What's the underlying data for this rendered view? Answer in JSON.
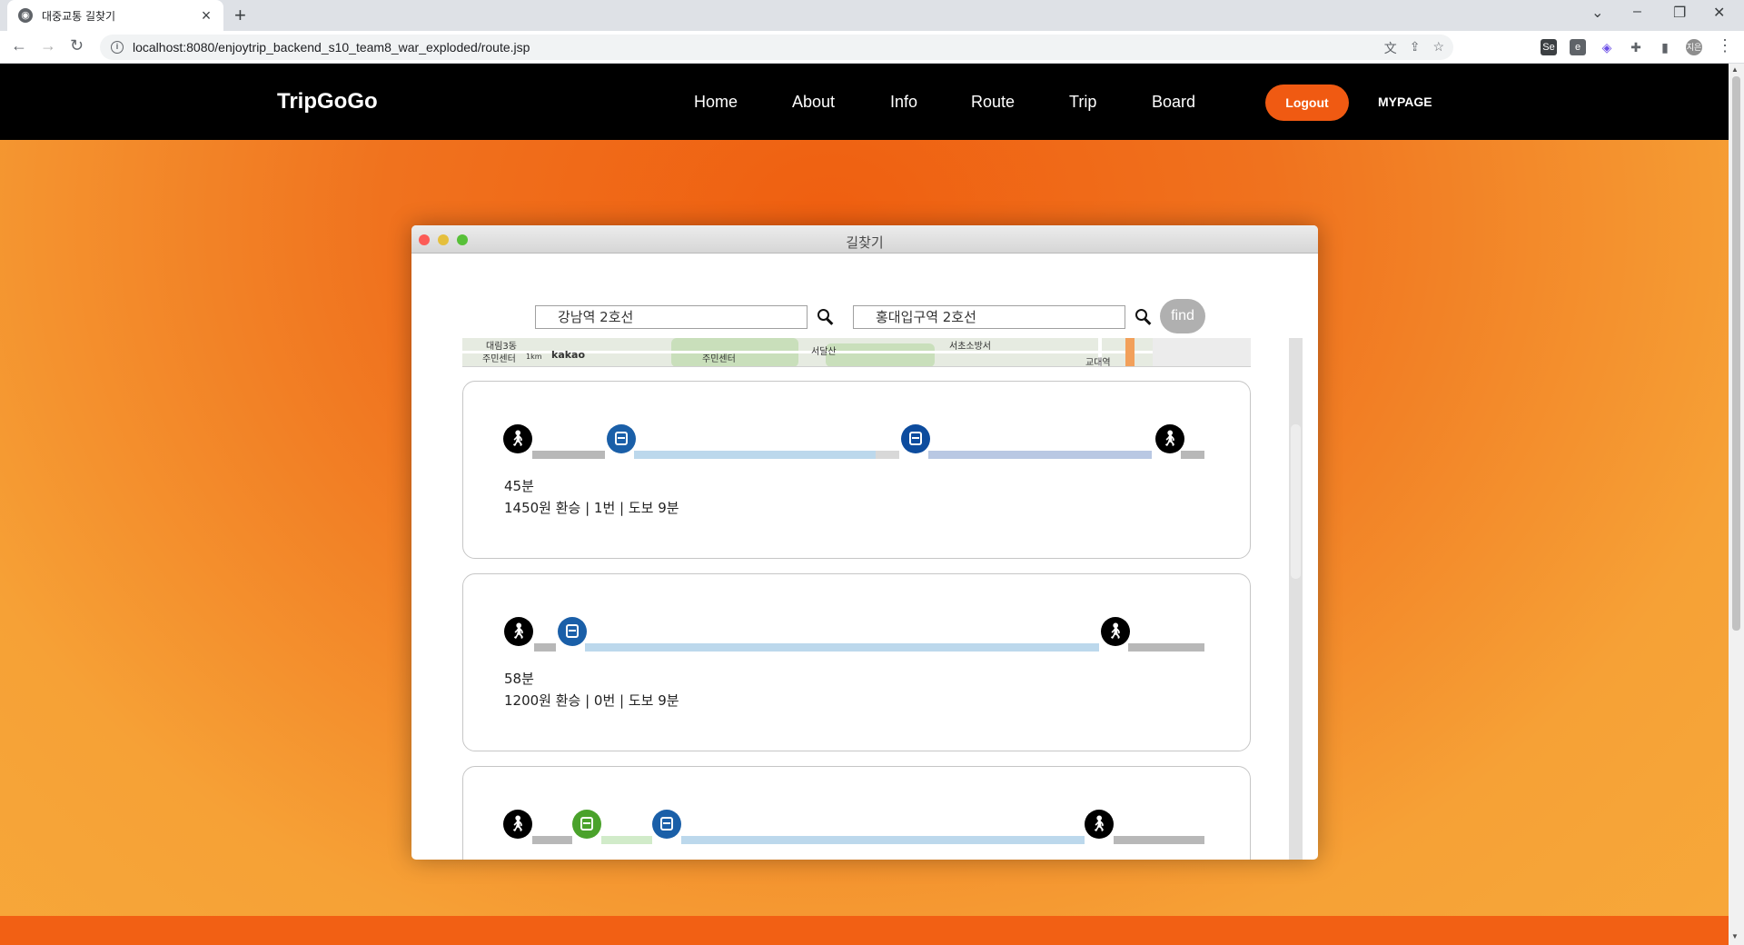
{
  "browser": {
    "tab_title": "대중교통 길찾기",
    "url": "localhost:8080/enjoytrip_backend_s10_team8_war_exploded/route.jsp",
    "profile_initial": "지은"
  },
  "site": {
    "brand": "TripGoGo",
    "menu": [
      "Home",
      "About",
      "Info",
      "Route",
      "Trip",
      "Board"
    ],
    "logout_label": "Logout",
    "mypage_label": "MYPAGE"
  },
  "window": {
    "title": "길찾기",
    "origin_value": "강남역 2호선",
    "destination_value": "홍대입구역 2호선",
    "find_label": "find"
  },
  "map": {
    "labels": [
      "대림3동",
      "주민센터",
      "1km",
      "kakao",
      "주민센터",
      "서달산",
      "서초소방서",
      "교대역"
    ]
  },
  "colors": {
    "walk": "#000000",
    "walk_segment": "#b8b8b8",
    "bus_blue": "#1a5fa8",
    "bus_dark_blue": "#0d4c9e",
    "bus_green": "#4aa22b",
    "segment_blue": "#bcd8ec",
    "segment_periwinkle": "#b9c8e3",
    "segment_green": "#d1ebc9",
    "accent_orange": "#f05a12"
  },
  "routes": [
    {
      "time": "45분",
      "info": "1450원 환승 | 1번 | 도보 9분",
      "icons": [
        "walk-icon",
        "bus-icon",
        "bus-icon",
        "walk-icon"
      ]
    },
    {
      "time": "58분",
      "info": "1200원 환승 | 0번 | 도보 9분",
      "icons": [
        "walk-icon",
        "bus-icon",
        "walk-icon"
      ]
    },
    {
      "time": "",
      "info": "",
      "icons": [
        "walk-icon",
        "bus-icon",
        "bus-icon",
        "walk-icon"
      ]
    }
  ]
}
